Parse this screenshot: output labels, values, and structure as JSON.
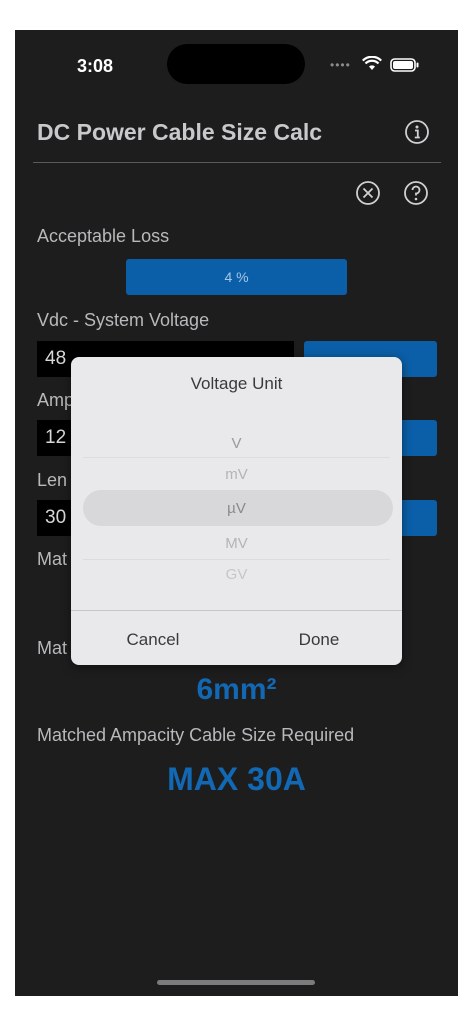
{
  "status_bar": {
    "time": "3:08"
  },
  "header": {
    "title": "DC Power Cable Size Calc"
  },
  "fields": {
    "acceptable_loss_label": "Acceptable Loss",
    "acceptable_loss_value": "4 %",
    "voltage_label": "Vdc - System Voltage",
    "voltage_value": "48",
    "amperage_label_partial": "Amp",
    "amperage_value": "12",
    "length_label_partial": "Len",
    "length_value": "30",
    "matched_label_partial_1": "Mat",
    "matched_label_partial_2": "Mat"
  },
  "results": {
    "cable_size": "6mm²",
    "ampacity_label": "Matched Ampacity Cable Size Required",
    "ampacity_value": "MAX 30A"
  },
  "dialog": {
    "title": "Voltage Unit",
    "options": [
      "V",
      "mV",
      "µV",
      "MV",
      "GV"
    ],
    "selected": "µV",
    "cancel_label": "Cancel",
    "done_label": "Done"
  },
  "colors": {
    "accent": "#0b5fa8",
    "result_text": "#1268b3",
    "background": "#1d1d1e"
  }
}
